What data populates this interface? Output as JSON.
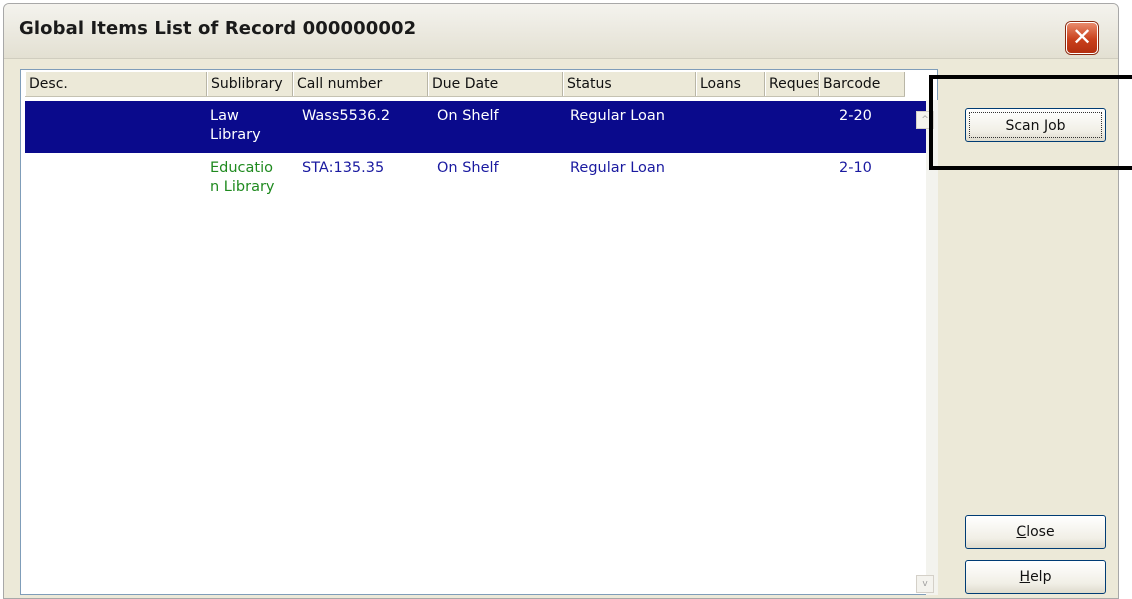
{
  "window": {
    "title": "Global Items List of Record 000000002",
    "close_glyph": "✕"
  },
  "table": {
    "columns": [
      "Desc.",
      "Sublibrary",
      "Call number",
      "Due Date",
      "Status",
      "Loans",
      "Reques",
      "Barcode"
    ],
    "rows": [
      {
        "desc": "",
        "sublibrary_line1": "Law",
        "sublibrary_line2": "Library",
        "call_number": "Wass5536.2",
        "due_date": "On Shelf",
        "status": "Regular Loan",
        "loans": "",
        "requests": "",
        "barcode": "2-20",
        "selected": true
      },
      {
        "desc": "",
        "sublibrary_line1": "Educatio",
        "sublibrary_line2": "n Library",
        "call_number": "STA:135.35",
        "due_date": "On Shelf",
        "status": "Regular Loan",
        "loans": "",
        "requests": "",
        "barcode": "2-10",
        "selected": false
      }
    ]
  },
  "buttons": {
    "scan_job": "Scan Job",
    "close_hotkey": "C",
    "close_rest": "lose",
    "help_hotkey": "H",
    "help_rest": "elp"
  },
  "icons": {
    "scroll_up": "^",
    "scroll_down": "v"
  },
  "colors": {
    "selection": "#0a0a8c",
    "education_sublibrary": "#1f8a1f",
    "text_blue": "#1a1aa0"
  }
}
